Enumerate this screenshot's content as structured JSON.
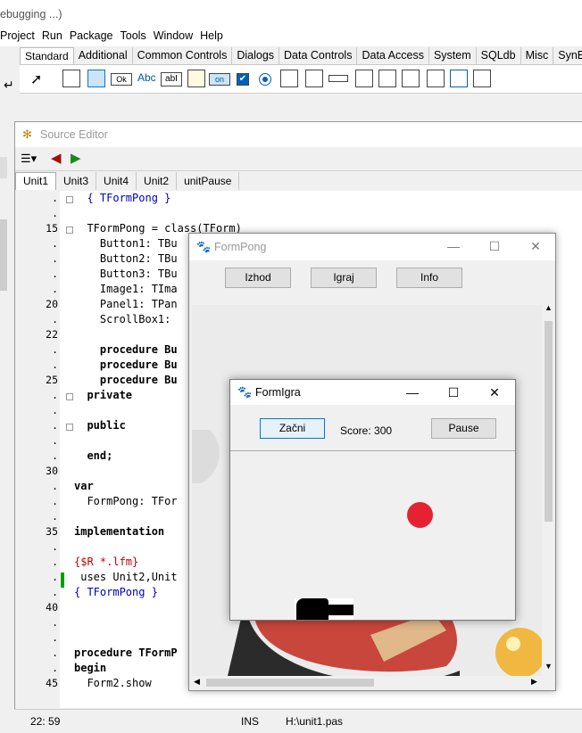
{
  "main_window": {
    "title_fragment": "ebugging ...)"
  },
  "menu": [
    "Project",
    "Run",
    "Package",
    "Tools",
    "Window",
    "Help"
  ],
  "palette_tabs": [
    "Standard",
    "Additional",
    "Common Controls",
    "Dialogs",
    "Data Controls",
    "Data Access",
    "System",
    "SQLdb",
    "Misc",
    "SynEd"
  ],
  "palette_icon_labels": {
    "ok": "Ok",
    "abc": "Abc",
    "abi": "abI",
    "on": "on"
  },
  "source_editor": {
    "title": "Source Editor",
    "tabs": [
      "Unit1",
      "Unit3",
      "Unit4",
      "Unit2",
      "unitPause"
    ],
    "line_numbers": [
      ".",
      ".",
      "15",
      ".",
      ".",
      ".",
      ".",
      "20",
      ".",
      "22",
      ".",
      ".",
      "25",
      ".",
      ".",
      ".",
      ".",
      ".",
      "30",
      ".",
      ".",
      ".",
      "35",
      ".",
      ".",
      ".",
      ".",
      "40",
      ".",
      ".",
      ".",
      ".",
      "45"
    ],
    "code_lines": [
      {
        "t": "  { TFormPong }",
        "c": "blue"
      },
      {
        "t": "",
        "c": ""
      },
      {
        "t": "  TFormPong = class(TForm)",
        "c": ""
      },
      {
        "t": "    Button1: TBu",
        "c": ""
      },
      {
        "t": "    Button2: TBu",
        "c": ""
      },
      {
        "t": "    Button3: TBu",
        "c": ""
      },
      {
        "t": "    Image1: TIma",
        "c": ""
      },
      {
        "t": "    Panel1: TPan",
        "c": ""
      },
      {
        "t": "    ScrollBox1: ",
        "c": ""
      },
      {
        "t": "",
        "c": ""
      },
      {
        "t": "    procedure Bu",
        "c": "kw"
      },
      {
        "t": "    procedure Bu",
        "c": "kw"
      },
      {
        "t": "    procedure Bu",
        "c": "kw"
      },
      {
        "t": "  private",
        "c": "kw"
      },
      {
        "t": "",
        "c": ""
      },
      {
        "t": "  public",
        "c": "kw"
      },
      {
        "t": "",
        "c": ""
      },
      {
        "t": "  end;",
        "c": "kw"
      },
      {
        "t": "",
        "c": ""
      },
      {
        "t": "var",
        "c": "kw"
      },
      {
        "t": "  FormPong: TFor",
        "c": ""
      },
      {
        "t": "",
        "c": ""
      },
      {
        "t": "implementation",
        "c": "kw"
      },
      {
        "t": "",
        "c": ""
      },
      {
        "t": "{$R *.lfm}",
        "c": "red"
      },
      {
        "t": " uses Unit2,Unit",
        "c": ""
      },
      {
        "t": "{ TFormPong }",
        "c": "blue"
      },
      {
        "t": "",
        "c": ""
      },
      {
        "t": "",
        "c": ""
      },
      {
        "t": "",
        "c": ""
      },
      {
        "t": "procedure TFormP",
        "c": "kw"
      },
      {
        "t": "begin",
        "c": "kw"
      },
      {
        "t": "  Form2.show",
        "c": ""
      }
    ]
  },
  "status": {
    "position": "22: 59",
    "mode": "INS",
    "file": "H:\\unit1.pas"
  },
  "form_pong": {
    "title": "FormPong",
    "buttons": {
      "exit": "Izhod",
      "play": "Igraj",
      "info": "Info"
    }
  },
  "form_igra": {
    "title": "FormIgra",
    "start_button": "Začni",
    "score": "Score: 300",
    "pause_button": "Pause"
  },
  "colors": {
    "ball": "#e52231",
    "paddle": "#c0392b",
    "accent": "#0078d7"
  }
}
